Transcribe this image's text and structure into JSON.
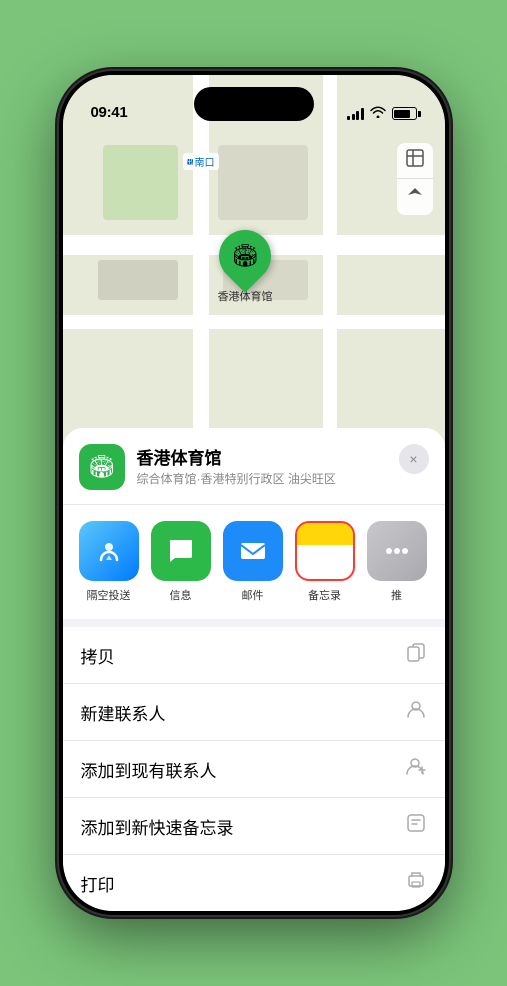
{
  "status_bar": {
    "time": "09:41",
    "location_arrow": "▶"
  },
  "map": {
    "south_entrance_label": "南口",
    "south_entrance_prefix": "出",
    "controls": {
      "map_type_icon": "🗺",
      "location_icon": "⬆"
    },
    "venue_pin": {
      "label": "香港体育馆",
      "icon": "🏟"
    }
  },
  "venue_card": {
    "name": "香港体育馆",
    "description": "综合体育馆·香港特别行政区 油尖旺区",
    "close_label": "×"
  },
  "share_row": {
    "items": [
      {
        "id": "airdrop",
        "label": "隔空投送",
        "icon": "📡"
      },
      {
        "id": "messages",
        "label": "信息",
        "icon": "💬"
      },
      {
        "id": "mail",
        "label": "邮件",
        "icon": "✉"
      },
      {
        "id": "notes",
        "label": "备忘录",
        "icon": "📝",
        "selected": true
      },
      {
        "id": "more",
        "label": "推",
        "icon": "⋯"
      }
    ]
  },
  "action_list": {
    "items": [
      {
        "id": "copy",
        "label": "拷贝",
        "icon": "⎘"
      },
      {
        "id": "new-contact",
        "label": "新建联系人",
        "icon": "👤"
      },
      {
        "id": "add-existing",
        "label": "添加到现有联系人",
        "icon": "👤"
      },
      {
        "id": "add-notes",
        "label": "添加到新快速备忘录",
        "icon": "📋"
      },
      {
        "id": "print",
        "label": "打印",
        "icon": "🖨"
      }
    ]
  }
}
